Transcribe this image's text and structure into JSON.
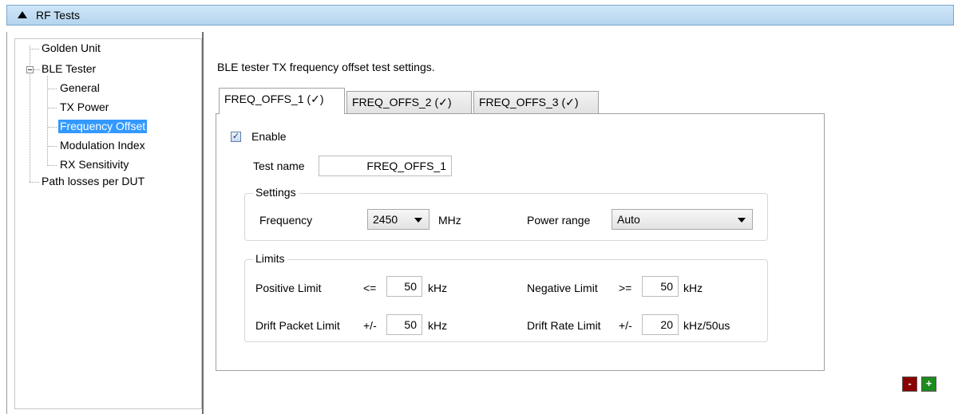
{
  "header": {
    "title": "RF Tests"
  },
  "tree": {
    "items": [
      {
        "label": "Golden Unit"
      },
      {
        "label": "BLE Tester"
      },
      {
        "label": "General"
      },
      {
        "label": "TX Power"
      },
      {
        "label": "Frequency Offset"
      },
      {
        "label": "Modulation Index"
      },
      {
        "label": "RX Sensitivity"
      },
      {
        "label": "Path losses per DUT"
      }
    ]
  },
  "main": {
    "description": "BLE tester TX frequency offset test settings.",
    "tabs": [
      {
        "label": "FREQ_OFFS_1 (✓)"
      },
      {
        "label": "FREQ_OFFS_2 (✓)"
      },
      {
        "label": "FREQ_OFFS_3 (✓)"
      }
    ],
    "enable": {
      "label": "Enable",
      "mark": "✓"
    },
    "test_name": {
      "label": "Test name",
      "value": "FREQ_OFFS_1"
    },
    "settings": {
      "title": "Settings",
      "frequency_label": "Frequency",
      "frequency_value": "2450",
      "frequency_unit": "MHz",
      "power_range_label": "Power range",
      "power_range_value": "Auto"
    },
    "limits": {
      "title": "Limits",
      "positive_label": "Positive Limit",
      "positive_op": "<=",
      "positive_value": "50",
      "positive_unit": "kHz",
      "negative_label": "Negative Limit",
      "negative_op": ">=",
      "negative_value": "50",
      "negative_unit": "kHz",
      "drift_packet_label": "Drift Packet Limit",
      "drift_packet_op": "+/-",
      "drift_packet_value": "50",
      "drift_packet_unit": "kHz",
      "drift_rate_label": "Drift Rate Limit",
      "drift_rate_op": "+/-",
      "drift_rate_value": "20",
      "drift_rate_unit": "kHz/50us"
    },
    "buttons": {
      "remove": "-",
      "add": "+"
    }
  },
  "colors": {
    "selection": "#3399ff",
    "remove_button": "#8b0000",
    "add_button": "#1e8b1e",
    "header_bg": "#bcd9f2"
  }
}
